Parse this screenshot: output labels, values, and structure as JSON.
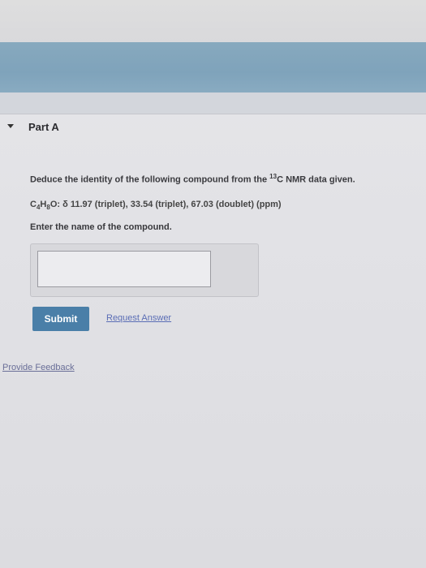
{
  "part": {
    "title": "Part A"
  },
  "question": {
    "pre": "Deduce the identity of the following compound from the ",
    "superscript": "13",
    "post": "C NMR data given."
  },
  "formula": {
    "c": "C",
    "c_sub": "4",
    "h": "H",
    "h_sub": "8",
    "o": "O",
    "data": ": δ 11.97 (triplet), 33.54 (triplet), 67.03 (doublet) (ppm)"
  },
  "prompt": "Enter the name of the compound.",
  "answer": {
    "value": "",
    "placeholder": ""
  },
  "buttons": {
    "submit": "Submit",
    "request_answer": "Request Answer"
  },
  "footer": {
    "provide_feedback": "Provide Feedback"
  }
}
